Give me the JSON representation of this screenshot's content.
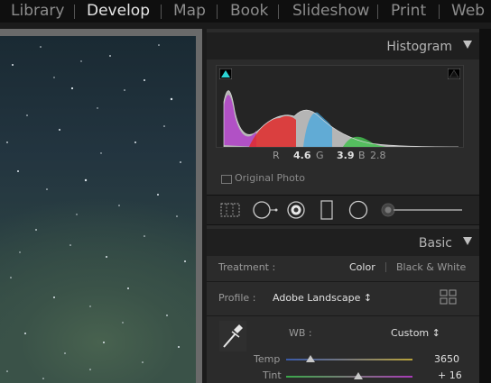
{
  "nav": {
    "modules": [
      "Library",
      "Develop",
      "Map",
      "Book",
      "Slideshow",
      "Print",
      "Web"
    ],
    "active": "Develop"
  },
  "histogram": {
    "title": "Histogram",
    "r_label": "R",
    "r_value": "4.6",
    "g_label": "G",
    "g_value": "3.9",
    "b_label": "B",
    "b_value": "2.8",
    "original_photo_label": "Original Photo"
  },
  "tools": {
    "icons": [
      "crop-overlay-icon",
      "spot-removal-icon",
      "red-eye-icon",
      "graduated-filter-icon",
      "radial-filter-icon",
      "adjustment-brush-icon"
    ]
  },
  "basic": {
    "title": "Basic",
    "treatment_label": "Treatment :",
    "treatment_color": "Color",
    "treatment_bw": "Black & White",
    "profile_label": "Profile :",
    "profile_value": "Adobe Landscape ↕",
    "wb_label": "WB :",
    "wb_value": "Custom ↕",
    "temp_label": "Temp",
    "temp_value": "3650",
    "temp_level": 0.19,
    "tint_label": "Tint",
    "tint_value": "+ 16",
    "tint_level": 0.57
  }
}
